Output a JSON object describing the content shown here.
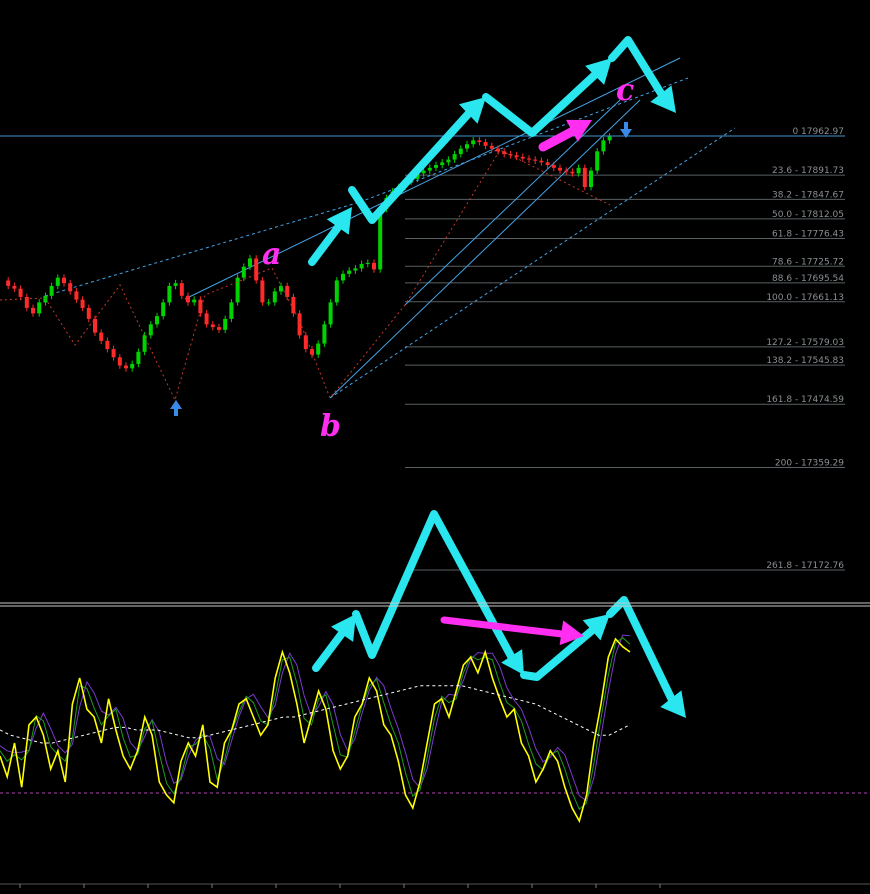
{
  "colors": {
    "background": "#000000",
    "bull_candle": "#00d400",
    "bear_candle": "#ff2a2a",
    "fib_line": "#6f777c",
    "fib_text": "#8a8f93",
    "channel": "#45a4e6",
    "arrow": "#29e6ef",
    "pink_arrow": "#ff2ef0",
    "wave_label": "#ff2ef0",
    "signal_arrow": "#3a8be8",
    "osc_main": "#ffff00",
    "osc_fast": "#1a9e1a",
    "osc_slow": "#7a3acc",
    "osc_ma": "#ffffff",
    "osc_level": "#b040b0"
  },
  "chart_data": {
    "type": "line",
    "title": "",
    "fibonacci_levels": [
      {
        "ratio": "0",
        "price": "17962.97"
      },
      {
        "ratio": "23.6",
        "price": "17891.73"
      },
      {
        "ratio": "38.2",
        "price": "17847.67"
      },
      {
        "ratio": "50.0",
        "price": "17812.05"
      },
      {
        "ratio": "61.8",
        "price": "17776.43"
      },
      {
        "ratio": "78.6",
        "price": "17725.72"
      },
      {
        "ratio": "88.6",
        "price": "17695.54"
      },
      {
        "ratio": "100.0",
        "price": "17661.13"
      },
      {
        "ratio": "127.2",
        "price": "17579.03"
      },
      {
        "ratio": "138.2",
        "price": "17545.83"
      },
      {
        "ratio": "161.8",
        "price": "17474.59"
      },
      {
        "ratio": "200",
        "price": "17359.29"
      },
      {
        "ratio": "261.8",
        "price": "17172.76"
      }
    ],
    "wave_labels": [
      "a",
      "b",
      "c"
    ],
    "price_path": [
      17700,
      17690,
      17685,
      17670,
      17650,
      17640,
      17660,
      17672,
      17690,
      17705,
      17695,
      17680,
      17665,
      17650,
      17630,
      17605,
      17590,
      17575,
      17560,
      17545,
      17540,
      17548,
      17570,
      17600,
      17620,
      17635,
      17660,
      17690,
      17695,
      17672,
      17660,
      17665,
      17640,
      17620,
      17615,
      17610,
      17630,
      17660,
      17705,
      17725,
      17740,
      17700,
      17660,
      17660,
      17680,
      17690,
      17670,
      17640,
      17600,
      17575,
      17565,
      17585,
      17620,
      17660,
      17700,
      17712,
      17718,
      17722,
      17730,
      17732,
      17720,
      17830,
      17850,
      17862,
      17870,
      17880,
      17885,
      17895,
      17900,
      17905,
      17910,
      17915,
      17920,
      17930,
      17940,
      17948,
      17955,
      17952,
      17945,
      17940,
      17935,
      17930,
      17928,
      17925,
      17922,
      17920,
      17918,
      17915,
      17910,
      17905,
      17900,
      17898,
      17895,
      17905,
      17870,
      17900,
      17935,
      17955,
      17962
    ],
    "oscillator": {
      "main": [
        40,
        32,
        45,
        28,
        52,
        55,
        48,
        35,
        42,
        30,
        60,
        70,
        58,
        55,
        45,
        62,
        50,
        40,
        35,
        42,
        55,
        48,
        30,
        25,
        22,
        38,
        45,
        40,
        52,
        30,
        28,
        45,
        50,
        60,
        62,
        55,
        48,
        52,
        70,
        80,
        72,
        60,
        45,
        55,
        65,
        58,
        42,
        35,
        40,
        55,
        60,
        70,
        65,
        52,
        48,
        38,
        25,
        20,
        30,
        45,
        60,
        62,
        55,
        65,
        75,
        78,
        72,
        80,
        70,
        62,
        55,
        58,
        45,
        40,
        30,
        35,
        42,
        38,
        28,
        20,
        15,
        25,
        45,
        60,
        78,
        85,
        82,
        80
      ],
      "ma": [
        50,
        48,
        47,
        46,
        45,
        45,
        46,
        47,
        48,
        49,
        50,
        51,
        51,
        50,
        50,
        50,
        49,
        48,
        47,
        47,
        48,
        49,
        50,
        51,
        52,
        53,
        54,
        55,
        55,
        56,
        57,
        58,
        59,
        60,
        61,
        62,
        63,
        64,
        65,
        66,
        67,
        67,
        67,
        67,
        67,
        66,
        65,
        64,
        63,
        62,
        61,
        60,
        58,
        56,
        54,
        52,
        50,
        48,
        48,
        50,
        52
      ]
    },
    "series": [
      {
        "name": "",
        "values": []
      }
    ]
  },
  "time_axis": [
    "",
    "",
    "",
    "",
    "",
    "",
    "",
    "",
    "",
    ""
  ]
}
